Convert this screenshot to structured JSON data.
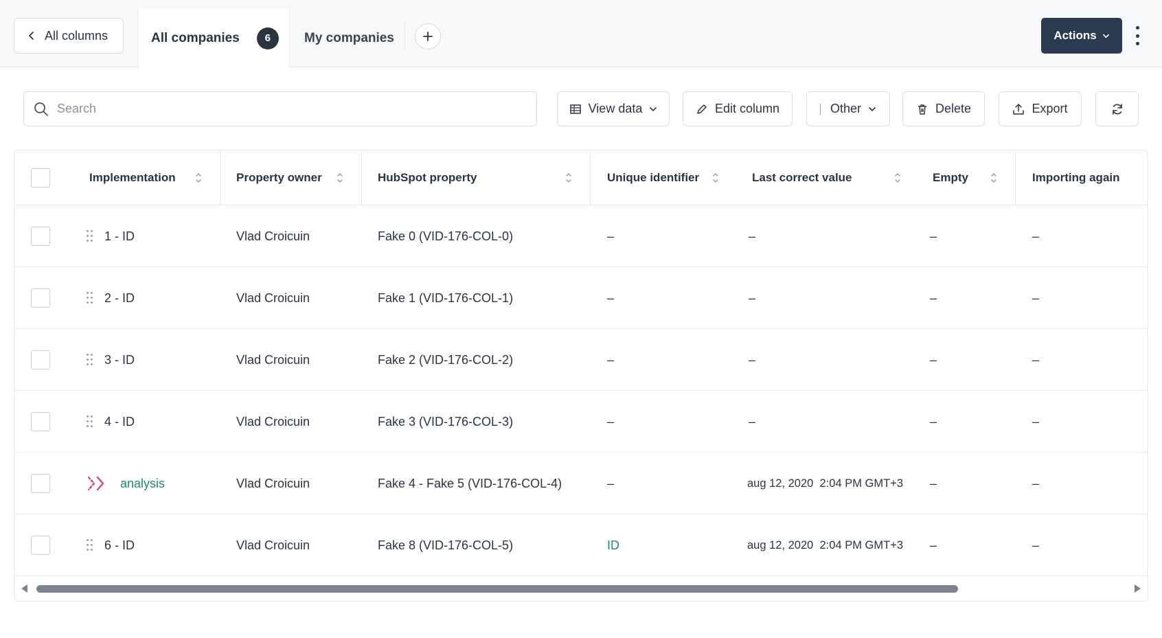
{
  "topbar": {
    "back_label": "All columns",
    "tabs": [
      {
        "label": "All companies",
        "count": "6"
      },
      {
        "label": "My companies"
      }
    ],
    "actions_label": "Actions"
  },
  "toolbar": {
    "search_placeholder": "Search",
    "view_data_label": "View data",
    "edit_column_label": "Edit column",
    "other_label": "Other",
    "delete_label": "Delete",
    "export_label": "Export"
  },
  "table": {
    "columns": [
      "Implementation",
      "Property owner",
      "HubSpot property",
      "Unique identifier",
      "Last correct value",
      "Empty",
      "Importing again"
    ],
    "rows": [
      {
        "implementation": "1 - ID",
        "owner": "Vlad Croicuin",
        "property": "Fake 0 (VID-176-COL-0)",
        "unique": "–",
        "last_value": "–",
        "empty": "–",
        "importing": "–"
      },
      {
        "implementation": "2 - ID",
        "owner": "Vlad Croicuin",
        "property": "Fake 1 (VID-176-COL-1)",
        "unique": "–",
        "last_value": "–",
        "empty": "–",
        "importing": "–"
      },
      {
        "implementation": "3 - ID",
        "owner": "Vlad Croicuin",
        "property": "Fake 2 (VID-176-COL-2)",
        "unique": "–",
        "last_value": "–",
        "empty": "–",
        "importing": "–"
      },
      {
        "implementation": "4 - ID",
        "owner": "Vlad Croicuin",
        "property": "Fake 3 (VID-176-COL-3)",
        "unique": "–",
        "last_value": "–",
        "empty": "–",
        "importing": "–"
      },
      {
        "implementation": "analysis",
        "owner": "Vlad Croicuin",
        "property": "Fake 4 - Fake 5 (VID-176-COL-4)",
        "unique": "–",
        "last_value": "aug 12, 2020  2:04 PM GMT+3",
        "empty": "–",
        "importing": "–"
      },
      {
        "implementation": "6 - ID",
        "owner": "Vlad Croicuin",
        "property": "Fake 8 (VID-176-COL-5)",
        "unique": "ID",
        "last_value": "aug 12, 2020  2:04 PM GMT+3",
        "empty": "–",
        "importing": "–"
      }
    ]
  },
  "colors": {
    "primary_dark": "#2b3a4f",
    "accent_green": "#1e8a6e",
    "accent_pink": "#e0406a"
  }
}
